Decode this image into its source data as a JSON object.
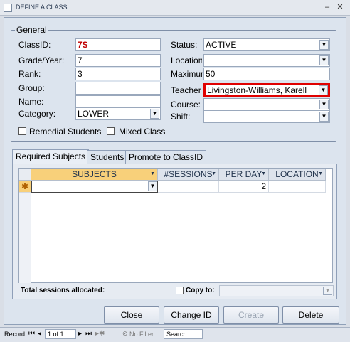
{
  "window": {
    "title": "DEFINE A CLASS",
    "minimize": "–",
    "close": "✕"
  },
  "general": {
    "legend": "General",
    "classid_label": "ClassID:",
    "classid_value": "7S",
    "grade_label": "Grade/Year:",
    "grade_value": "7",
    "rank_label": "Rank:",
    "rank_value": "3",
    "group_label": "Group:",
    "group_value": "",
    "name_label": "Name:",
    "name_value": "",
    "category_label": "Category:",
    "category_value": "LOWER",
    "status_label": "Status:",
    "status_value": "ACTIVE",
    "location_label": "Location",
    "location_value": "",
    "maximum_label": "Maximum",
    "maximum_value": "50",
    "teacher_label": "Teacher",
    "teacher_value": "Livingston-Williams, Karell",
    "course_label": "Course:",
    "course_value": "",
    "shift_label": "Shift:",
    "shift_value": "",
    "remedial_label": "Remedial Students",
    "mixed_label": "Mixed Class"
  },
  "tabs": [
    "Required Subjects",
    "Students",
    "Promote to ClassID"
  ],
  "grid": {
    "columns": [
      "SUBJECTS",
      "#SESSIONS",
      "PER DAY",
      "LOCATION"
    ],
    "new_row_marker": "✱",
    "new_row": {
      "subject": "",
      "sessions": "",
      "per_day": "2",
      "location": ""
    }
  },
  "footer": {
    "total_label": "Total sessions allocated:",
    "copy_label": "Copy to:",
    "copy_value": ""
  },
  "buttons": {
    "close": "Close",
    "change_id": "Change ID",
    "create": "Create",
    "delete": "Delete"
  },
  "statusbar": {
    "record_label": "Record:",
    "record_value": "1 of 1",
    "filter": "No Filter",
    "search": "Search"
  },
  "colors": {
    "highlight": "#e00000",
    "classid_text": "#c00000"
  }
}
